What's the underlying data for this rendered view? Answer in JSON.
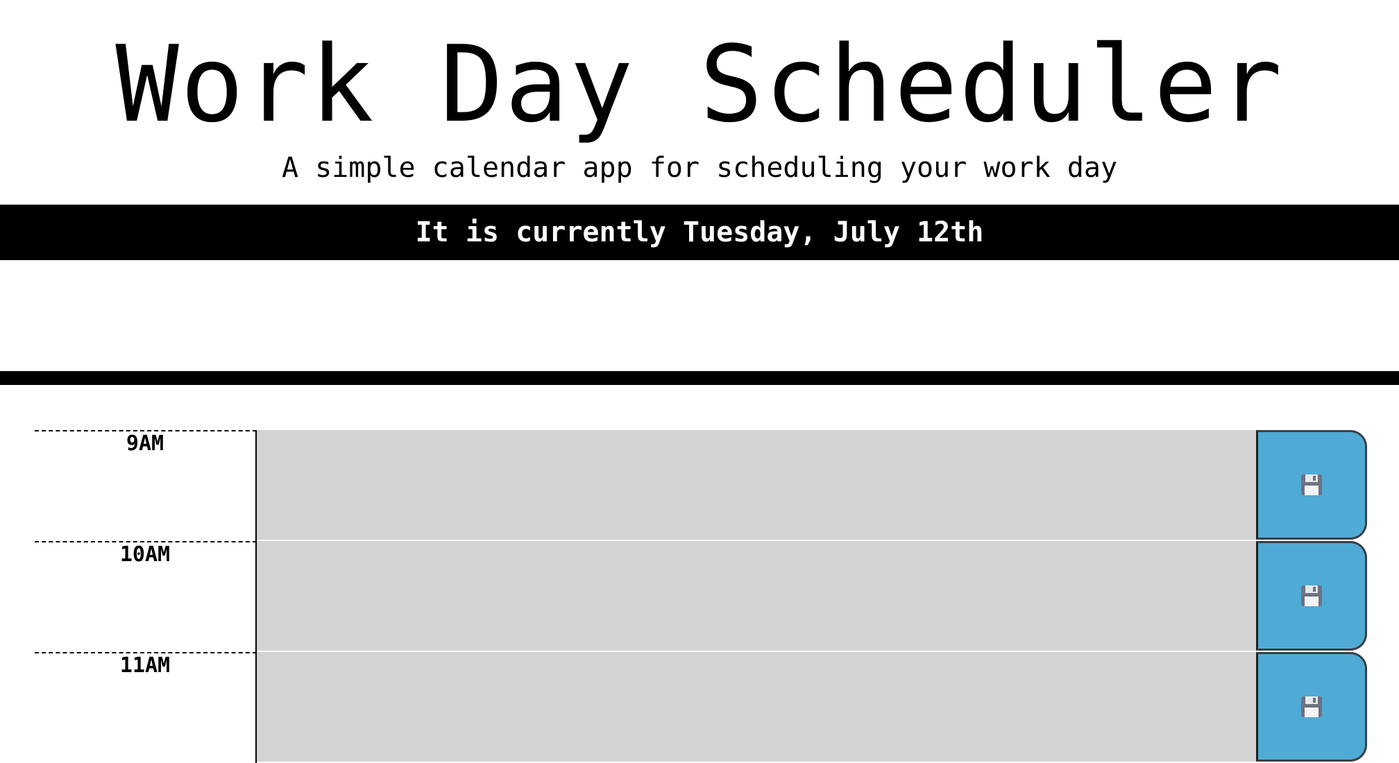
{
  "header": {
    "title": "Work Day Scheduler",
    "lead": "A simple calendar app for scheduling your work day",
    "current_day": "It is currently Tuesday, July 12th"
  },
  "timeblocks": [
    {
      "hour": "9AM",
      "text": "",
      "status": "past"
    },
    {
      "hour": "10AM",
      "text": "",
      "status": "past"
    },
    {
      "hour": "11AM",
      "text": "",
      "status": "past"
    }
  ],
  "colors": {
    "past": "#d3d3d3",
    "save_button": "#4fabd5",
    "bar": "#000000"
  },
  "icons": {
    "save": "floppy-disk-icon"
  }
}
